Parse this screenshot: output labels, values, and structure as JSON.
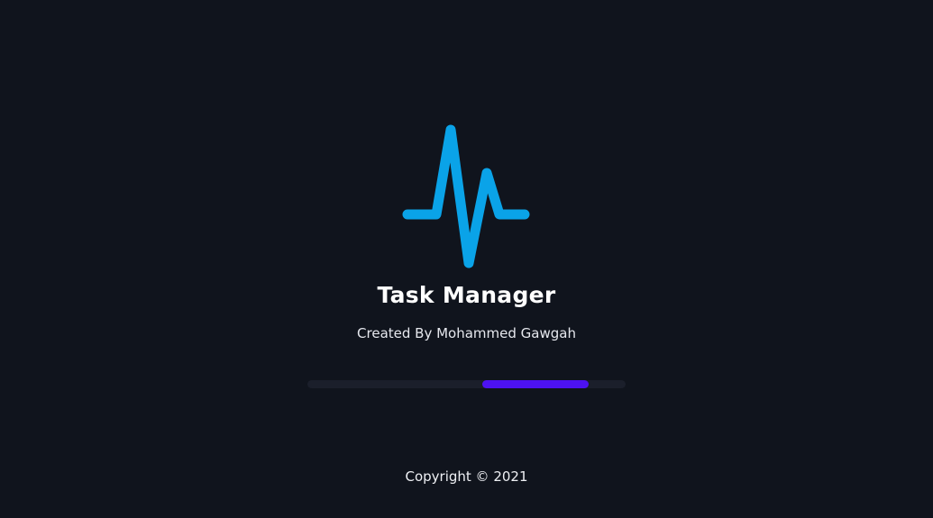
{
  "app": {
    "title": "Task Manager",
    "subtitle": "Created By Mohammed Gawgah",
    "copyright": "Copyright © 2021",
    "logo_icon": "heartbeat-pulse-icon"
  },
  "progress": {
    "start_fraction": 0.55,
    "end_fraction": 0.885
  },
  "colors": {
    "background": "#10141d",
    "logo": "#0aa3e8",
    "progress_track": "#1b1f2b",
    "progress_fill": "#4d12f2",
    "text": "#ffffff"
  }
}
